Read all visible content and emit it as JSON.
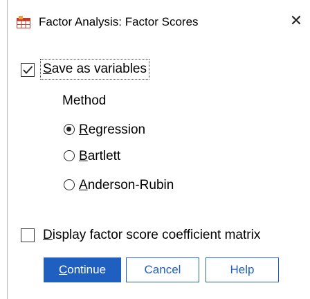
{
  "window": {
    "title": "Factor Analysis: Factor Scores",
    "close_glyph": "✕"
  },
  "save_variables": {
    "label_first": "S",
    "label_rest": "ave as variables",
    "checked": true
  },
  "method": {
    "title": "Method",
    "options": [
      {
        "first": "R",
        "rest": "egression",
        "selected": true
      },
      {
        "first": "B",
        "rest": "artlett",
        "selected": false
      },
      {
        "first": "A",
        "rest": "nderson-Rubin",
        "selected": false
      }
    ]
  },
  "display_matrix": {
    "label_first": "D",
    "label_rest": "isplay factor score coefficient matrix",
    "checked": false
  },
  "buttons": {
    "continue_first": "C",
    "continue_rest": "ontinue",
    "cancel": "Cancel",
    "help": "Help"
  },
  "colors": {
    "accent": "#1f5fbf",
    "icon_red": "#c0392b"
  },
  "icons": {
    "app": "spss-table-icon",
    "close": "close-icon",
    "check": "checkmark-icon"
  }
}
